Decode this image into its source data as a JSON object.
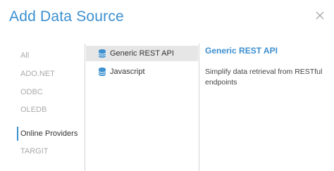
{
  "dialog": {
    "title": "Add Data Source"
  },
  "categories": [
    {
      "label": "All"
    },
    {
      "label": "ADO.NET"
    },
    {
      "label": "ODBC"
    },
    {
      "label": "OLEDB"
    },
    {
      "label": "Online Providers",
      "selected": true
    },
    {
      "label": "TARGIT"
    }
  ],
  "sources": [
    {
      "label": "Generic REST API",
      "icon": "database-icon",
      "selected": true
    },
    {
      "label": "Javascript",
      "icon": "database-icon"
    }
  ],
  "detail": {
    "title": "Generic REST API",
    "description": "Simplify data retrieval from RESTful endpoints"
  },
  "colors": {
    "accent": "#3b8fd0",
    "selected_bg": "#e6e6e6",
    "muted_text": "#a9a9a9"
  }
}
